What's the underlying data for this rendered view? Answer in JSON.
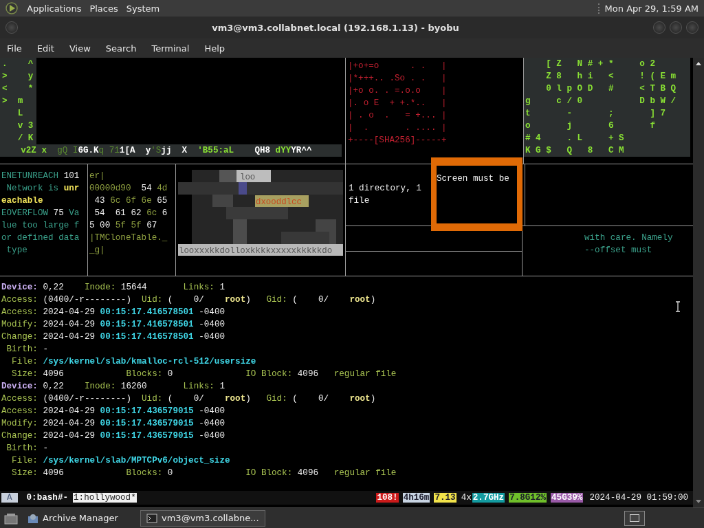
{
  "top_panel": {
    "menus": [
      "Applications",
      "Places",
      "System"
    ],
    "clock": "Mon Apr 29, 1:59 AM"
  },
  "window": {
    "title": "vm3@vm3.collabnet.local (192.168.1.13) - byobu"
  },
  "menu_bar": [
    "File",
    "Edit",
    "View",
    "Search",
    "Terminal",
    "Help"
  ],
  "panes": {
    "matrix_left": {
      "column": [
        ".    ^",
        ">    y",
        "<    *",
        ">  m",
        "   L",
        "   v 3",
        "   / K"
      ],
      "bottom_line": [
        {
          "text": "    v2Z x  ",
          "kind": "bright"
        },
        {
          "text": "gQ I",
          "kind": "dim"
        },
        {
          "text": "6G.K",
          "kind": "white"
        },
        {
          "text": "q 71",
          "kind": "dim"
        },
        {
          "text": "1[A  y",
          "kind": "white"
        },
        {
          "text": "'S",
          "kind": "dim"
        },
        {
          "text": "jj  X  ",
          "kind": "white"
        },
        {
          "text": "'B55:aL    ",
          "kind": "bright"
        },
        {
          "text": "QH8 ",
          "kind": "white"
        },
        {
          "text": "dYY",
          "kind": "bright"
        },
        {
          "text": "YR^^",
          "kind": "white"
        }
      ]
    },
    "randomart": [
      "|+o+=o      . .   |",
      "|*+++.. .So . .   |",
      "|+o o. . =.o.o    |",
      "|. o E  + +.*..   |",
      "| . o  .   = +... |",
      "|  .       . .... |",
      "+----[SHA256]-----+"
    ],
    "matrix_right": [
      "    [ Z   N # + *     o 2",
      "    Z 8   h i   <     ! ( E m",
      "    0 l p O D   #     < T B Q",
      "g     c / 0           D b W /",
      "t       -       ;       ] 7",
      "o       j       6       f",
      "# 4     . L     + S",
      "K G $   Q   8   C M"
    ],
    "errno": [
      [
        {
          "text": "ENETUNREACH ",
          "kind": "text"
        },
        {
          "text": "101",
          "kind": "value"
        }
      ],
      [
        {
          "text": " Network is ",
          "kind": "text"
        },
        {
          "text": "unr",
          "kind": "highlight"
        }
      ],
      [
        {
          "text": "eachable",
          "kind": "highlight"
        }
      ],
      [
        {
          "text": "EOVERFLOW ",
          "kind": "text"
        },
        {
          "text": "75 ",
          "kind": "value"
        },
        {
          "text": "Va",
          "kind": "text"
        }
      ],
      [
        {
          "text": "lue too large f",
          "kind": "text"
        }
      ],
      [
        {
          "text": "or defined data",
          "kind": "text"
        }
      ],
      [
        {
          "text": " type",
          "kind": "text"
        }
      ]
    ],
    "hexdump": [
      [
        {
          "text": "er|",
          "kind": "offset"
        }
      ],
      [
        {
          "text": "00000d90  ",
          "kind": "offset"
        },
        {
          "text": "54 ",
          "kind": "value"
        },
        {
          "text": "4d",
          "kind": "offset"
        }
      ],
      [
        {
          "text": " 43 ",
          "kind": "value"
        },
        {
          "text": "6c 6f 6e ",
          "kind": "offset"
        },
        {
          "text": "65",
          "kind": "value"
        }
      ],
      [
        {
          "text": " 54  61 62 ",
          "kind": "value"
        },
        {
          "text": "6c ",
          "kind": "offset"
        },
        {
          "text": "6",
          "kind": "value"
        }
      ],
      [
        {
          "text": "5 00 ",
          "kind": "value"
        },
        {
          "text": "5f 5f ",
          "kind": "offset"
        },
        {
          "text": "67",
          "kind": "value"
        }
      ],
      [
        {
          "text": "|TMCloneTable._",
          "kind": "offset"
        }
      ],
      [
        {
          "text": "_g|",
          "kind": "offset"
        }
      ]
    ],
    "art_texts": [
      "loo",
      "dxooddlcc",
      "looxxxkkdolloxkkkkxxxxxkkkkkdo"
    ],
    "tree_summary": [
      "1 directory, 1",
      "file"
    ],
    "alert": "Screen must be",
    "man_text": [
      "with care. Namely",
      "--offset must"
    ]
  },
  "stat_lines": [
    [
      {
        "text": "Device:",
        "kind": "device"
      },
      {
        "text": " 0,22    ",
        "kind": "value"
      },
      {
        "text": "Inode:",
        "kind": "label"
      },
      {
        "text": " 15644       ",
        "kind": "value"
      },
      {
        "text": "Links:",
        "kind": "label"
      },
      {
        "text": " 1",
        "kind": "value"
      }
    ],
    [
      {
        "text": "Access:",
        "kind": "label"
      },
      {
        "text": " (0400/-r--------)  ",
        "kind": "value"
      },
      {
        "text": "Uid:",
        "kind": "label"
      },
      {
        "text": " (    0/    ",
        "kind": "value"
      },
      {
        "text": "root",
        "kind": "owner"
      },
      {
        "text": ")   ",
        "kind": "value"
      },
      {
        "text": "Gid:",
        "kind": "label"
      },
      {
        "text": " (    0/    ",
        "kind": "value"
      },
      {
        "text": "root",
        "kind": "owner"
      },
      {
        "text": ")",
        "kind": "value"
      }
    ],
    [
      {
        "text": "Access:",
        "kind": "label"
      },
      {
        "text": " 2024-04-29 ",
        "kind": "value"
      },
      {
        "text": "00:15:17.416578501",
        "kind": "time"
      },
      {
        "text": " -0400",
        "kind": "value"
      }
    ],
    [
      {
        "text": "Modify:",
        "kind": "label"
      },
      {
        "text": " 2024-04-29 ",
        "kind": "value"
      },
      {
        "text": "00:15:17.416578501",
        "kind": "time"
      },
      {
        "text": " -0400",
        "kind": "value"
      }
    ],
    [
      {
        "text": "Change:",
        "kind": "label"
      },
      {
        "text": " 2024-04-29 ",
        "kind": "value"
      },
      {
        "text": "00:15:17.416578501",
        "kind": "time"
      },
      {
        "text": " -0400",
        "kind": "value"
      }
    ],
    [
      {
        "text": " Birth:",
        "kind": "label"
      },
      {
        "text": " -",
        "kind": "value"
      }
    ],
    [
      {
        "text": "  File: ",
        "kind": "label"
      },
      {
        "text": "/sys/kernel/slab/kmalloc-rcl-512/usersize",
        "kind": "path"
      }
    ],
    [
      {
        "text": "  Size:",
        "kind": "label"
      },
      {
        "text": " 4096            ",
        "kind": "value"
      },
      {
        "text": "Blocks:",
        "kind": "label"
      },
      {
        "text": " 0              ",
        "kind": "value"
      },
      {
        "text": "IO Block:",
        "kind": "label"
      },
      {
        "text": " 4096   ",
        "kind": "value"
      },
      {
        "text": "regular file",
        "kind": "label"
      }
    ],
    [
      {
        "text": "Device:",
        "kind": "device"
      },
      {
        "text": " 0,22    ",
        "kind": "value"
      },
      {
        "text": "Inode:",
        "kind": "label"
      },
      {
        "text": " 16260       ",
        "kind": "value"
      },
      {
        "text": "Links:",
        "kind": "label"
      },
      {
        "text": " 1",
        "kind": "value"
      }
    ],
    [
      {
        "text": "Access:",
        "kind": "label"
      },
      {
        "text": " (0400/-r--------)  ",
        "kind": "value"
      },
      {
        "text": "Uid:",
        "kind": "label"
      },
      {
        "text": " (    0/    ",
        "kind": "value"
      },
      {
        "text": "root",
        "kind": "owner"
      },
      {
        "text": ")   ",
        "kind": "value"
      },
      {
        "text": "Gid:",
        "kind": "label"
      },
      {
        "text": " (    0/    ",
        "kind": "value"
      },
      {
        "text": "root",
        "kind": "owner"
      },
      {
        "text": ")",
        "kind": "value"
      }
    ],
    [
      {
        "text": "Access:",
        "kind": "label"
      },
      {
        "text": " 2024-04-29 ",
        "kind": "value"
      },
      {
        "text": "00:15:17.436579015",
        "kind": "time"
      },
      {
        "text": " -0400",
        "kind": "value"
      }
    ],
    [
      {
        "text": "Modify:",
        "kind": "label"
      },
      {
        "text": " 2024-04-29 ",
        "kind": "value"
      },
      {
        "text": "00:15:17.436579015",
        "kind": "time"
      },
      {
        "text": " -0400",
        "kind": "value"
      }
    ],
    [
      {
        "text": "Change:",
        "kind": "label"
      },
      {
        "text": " 2024-04-29 ",
        "kind": "value"
      },
      {
        "text": "00:15:17.436579015",
        "kind": "time"
      },
      {
        "text": " -0400",
        "kind": "value"
      }
    ],
    [
      {
        "text": " Birth:",
        "kind": "label"
      },
      {
        "text": " -",
        "kind": "value"
      }
    ],
    [
      {
        "text": "  File: ",
        "kind": "label"
      },
      {
        "text": "/sys/kernel/slab/MPTCPv6/object_size",
        "kind": "path"
      }
    ],
    [
      {
        "text": "  Size:",
        "kind": "label"
      },
      {
        "text": " 4096            ",
        "kind": "value"
      },
      {
        "text": "Blocks:",
        "kind": "label"
      },
      {
        "text": " 0              ",
        "kind": "value"
      },
      {
        "text": "IO Block:",
        "kind": "label"
      },
      {
        "text": " 4096   ",
        "kind": "value"
      },
      {
        "text": "regular file",
        "kind": "label"
      }
    ]
  ],
  "status_bar": {
    "session": "A",
    "windows": [
      {
        "label": "0:bash#-",
        "selected": false
      },
      {
        "label": "1:hollywood*",
        "selected": true
      }
    ],
    "indicators": [
      {
        "text": "108!",
        "color": "#cc1a1a"
      },
      {
        "text": "4h16m",
        "color": "#c8d4e2"
      },
      {
        "text": "7.13",
        "color": "#f2e34a"
      },
      {
        "prefix": "4x",
        "text": "2.7GHz",
        "color": "#139ba0"
      },
      {
        "text": "7.8G12%",
        "color": "#6fbf2a"
      },
      {
        "text": "45G39%",
        "color": "#9a5aa8"
      }
    ],
    "datetime": "2024-04-29 01:59:00"
  },
  "taskbar": {
    "tasks": [
      {
        "label": "Archive Manager",
        "selected": false
      },
      {
        "label": "vm3@vm3.collabne...",
        "selected": true
      }
    ]
  }
}
